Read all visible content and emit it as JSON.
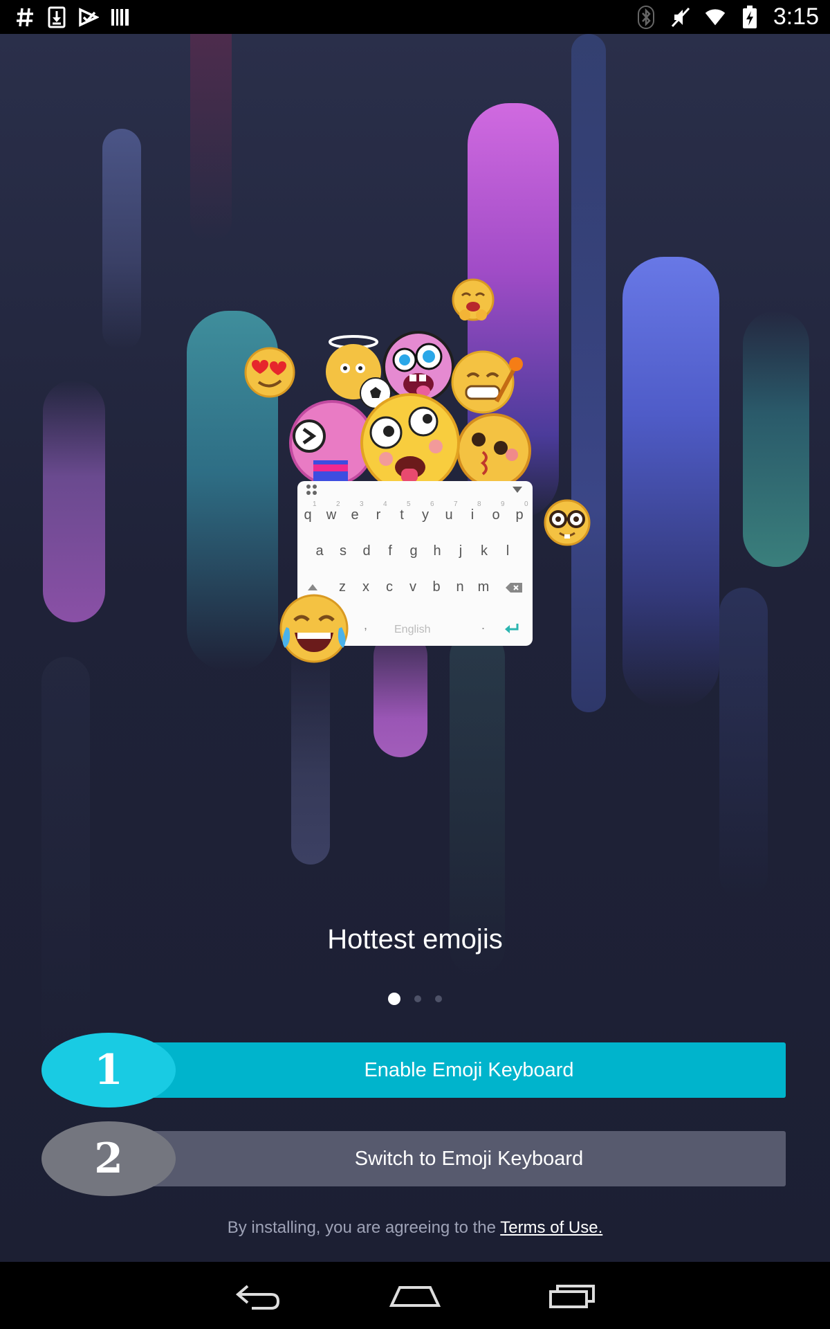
{
  "status_bar": {
    "time": "3:15",
    "left_icons": [
      "hash-icon",
      "download-icon",
      "play-store-icon",
      "barcode-icon"
    ],
    "right_icons": [
      "bluetooth-icon",
      "mute-icon",
      "wifi-icon",
      "battery-charging-icon"
    ]
  },
  "keyboard_preview": {
    "numbers": [
      "1",
      "2",
      "3",
      "4",
      "5",
      "6",
      "7",
      "8",
      "9",
      "0"
    ],
    "row1": [
      "q",
      "w",
      "e",
      "r",
      "t",
      "y",
      "u",
      "i",
      "o",
      "p"
    ],
    "row2": [
      "a",
      "s",
      "d",
      "f",
      "g",
      "h",
      "j",
      "k",
      "l"
    ],
    "row3": [
      "z",
      "x",
      "c",
      "v",
      "b",
      "n",
      "m"
    ],
    "space_label": "English",
    "comma": ",",
    "period": "."
  },
  "onboarding": {
    "headline": "Hottest emojis",
    "page_count": 3,
    "active_page": 0
  },
  "steps": [
    {
      "number": "1",
      "label": "Enable Emoji Keyboard",
      "color": "#00b4cc",
      "badge_color": "#19cbe3"
    },
    {
      "number": "2",
      "label": "Switch to Emoji Keyboard",
      "color": "#575a6e",
      "badge_color": "#74767f"
    }
  ],
  "terms": {
    "prefix": "By installing, you are agreeing to the ",
    "link": "Terms of Use."
  },
  "nav_bar": {
    "icons": [
      "back-icon",
      "home-icon",
      "recents-icon"
    ]
  }
}
